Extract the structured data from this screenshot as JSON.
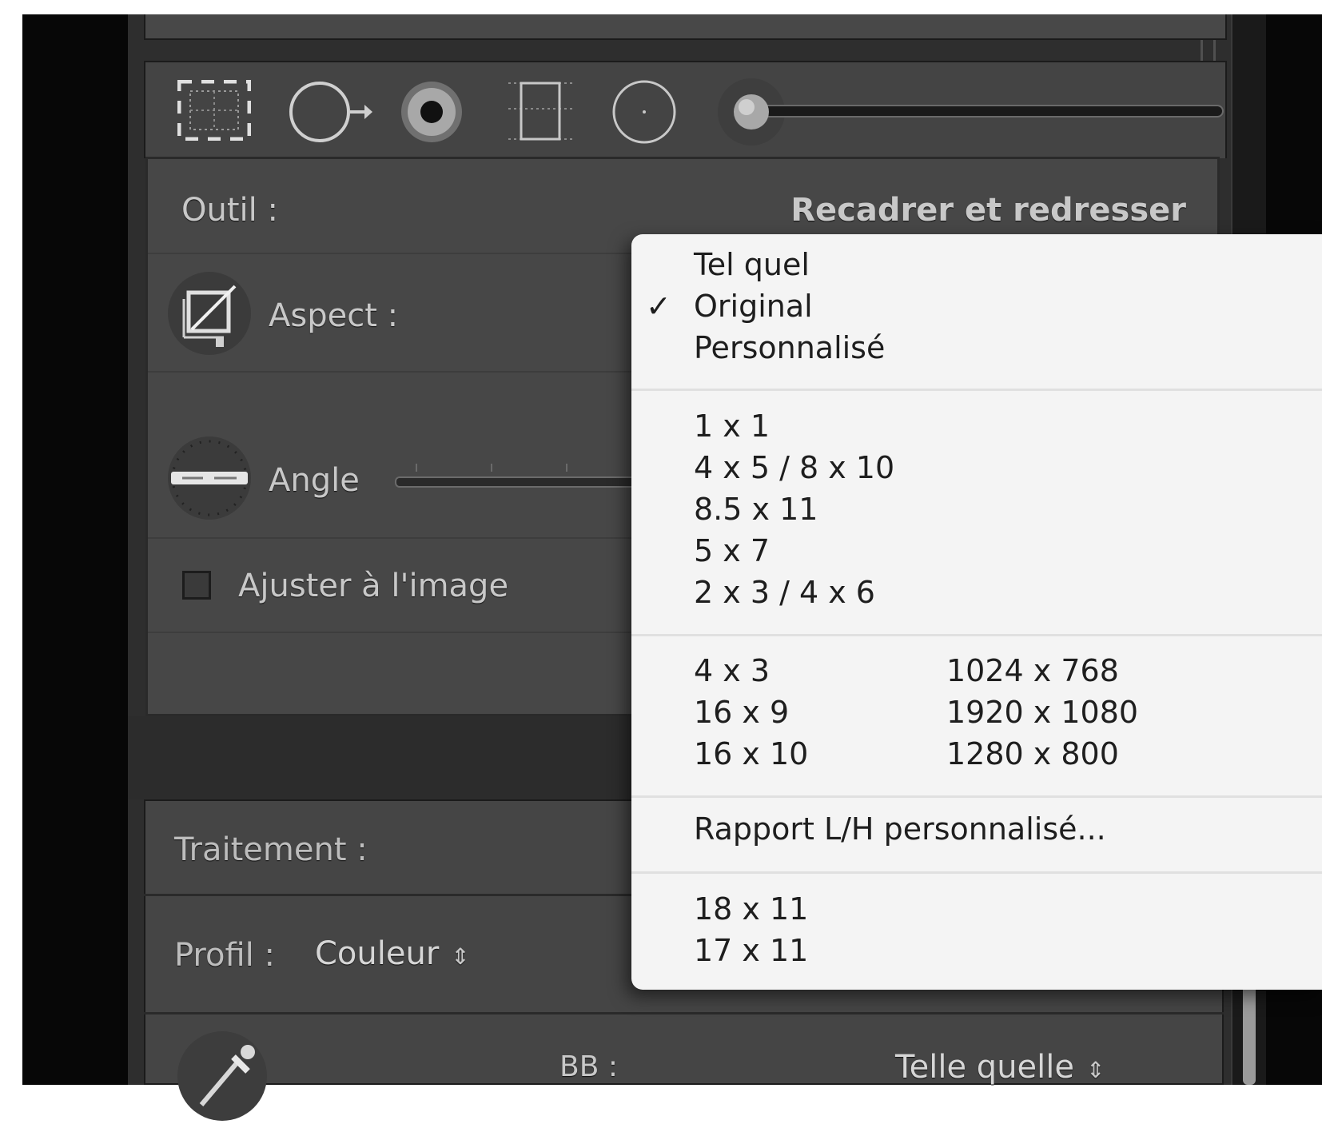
{
  "panel": {
    "tool_label": "Outil :",
    "tool_value": "Recadrer et redresser",
    "aspect_label": "Aspect :",
    "angle_label": "Angle",
    "constrain_label": "Ajuster à l'image",
    "treatment_label": "Traitement :",
    "profile_label": "Profil :",
    "profile_value": "Couleur",
    "wb_label": "BB :",
    "wb_value": "Telle quelle"
  },
  "toolbar": {
    "icons": [
      "crop-overlay-icon",
      "spot-removal-icon",
      "red-eye-icon",
      "graduated-filter-icon",
      "radial-filter-icon",
      "adjustment-brush-icon"
    ]
  },
  "aspect_menu": {
    "selected": "Original",
    "group1": [
      "Tel quel",
      "Original",
      "Personnalisé"
    ],
    "group2": [
      "1 x 1",
      "4 x 5  /  8 x 10",
      "8.5 x 11",
      "5 x 7",
      "2 x 3  /  4 x 6"
    ],
    "group3_left": [
      "4 x 3",
      "16 x 9",
      "16 x 10"
    ],
    "group3_right": [
      "1024 x 768",
      "1920 x 1080",
      "1280 x 800"
    ],
    "custom": "Rapport L/H personnalisé...",
    "group5": [
      "18 x 11",
      "17 x 11"
    ],
    "check_mark": "✓"
  }
}
